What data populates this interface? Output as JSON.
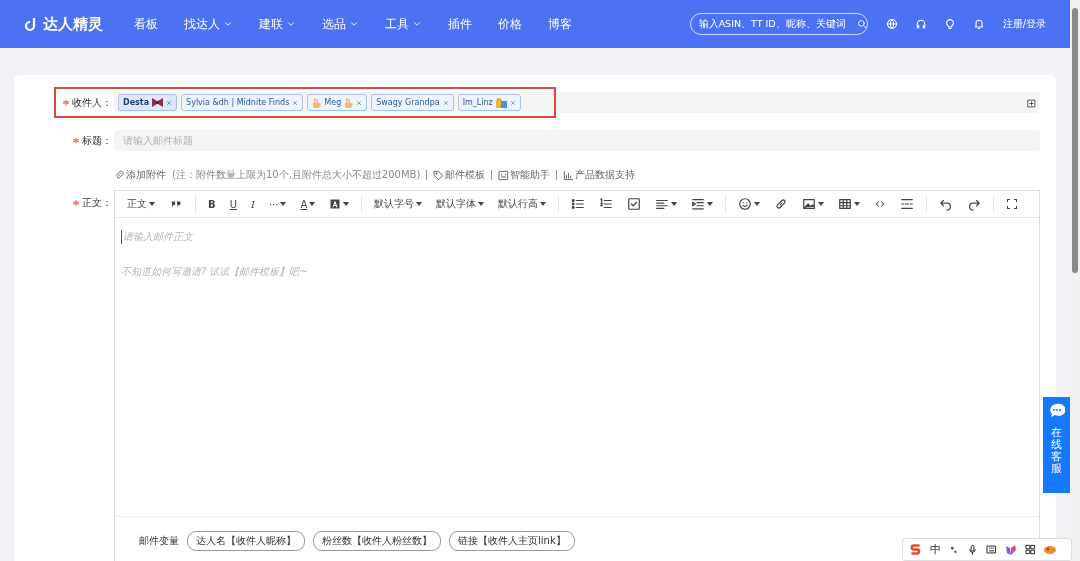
{
  "brand": {
    "name": "达人精灵"
  },
  "nav": [
    {
      "label": "看板",
      "has_menu": false
    },
    {
      "label": "找达人",
      "has_menu": true
    },
    {
      "label": "建联",
      "has_menu": true
    },
    {
      "label": "选品",
      "has_menu": true
    },
    {
      "label": "工具",
      "has_menu": true
    },
    {
      "label": "插件",
      "has_menu": false
    },
    {
      "label": "价格",
      "has_menu": false
    },
    {
      "label": "博客",
      "has_menu": false
    }
  ],
  "search": {
    "placeholder": "输入ASIN、TT ID、昵称、关键词"
  },
  "login": "注册/登录",
  "form": {
    "recipients": {
      "label": "收件人：",
      "required": true,
      "highlighted": true,
      "tags": [
        {
          "label": "Desta",
          "kind": "bow",
          "selected": true
        },
        {
          "label": "Sylvia &dh | Midnite Finds",
          "kind": "plain",
          "selected": false
        },
        {
          "label": "Meg",
          "kind": "hands",
          "selected": false
        },
        {
          "label": "Swagy Grandpa",
          "kind": "plain",
          "selected": false
        },
        {
          "label": "Im_Linz",
          "kind": "bag",
          "selected": false
        }
      ]
    },
    "subject": {
      "label": "标题：",
      "required": true,
      "placeholder": "请输入邮件标题"
    },
    "attachments": [
      {
        "kind": "clip",
        "label": "添加附件"
      },
      {
        "kind": "note",
        "label": "(注：附件数量上限为10个,且附件总大小不超过200MB)"
      },
      {
        "kind": "tag",
        "label": "邮件模板"
      },
      {
        "kind": "robot",
        "label": "智能助手"
      },
      {
        "kind": "chart",
        "label": "产品数据支持"
      }
    ],
    "body": {
      "label": "正文：",
      "required": true,
      "placeholder": "请输入邮件正文",
      "hint": "不知道如何写邀请? 试试【邮件模板】吧~",
      "toolbar": [
        [
          {
            "kind": "text",
            "label": "正文",
            "menu": true
          },
          {
            "kind": "quote"
          }
        ],
        [
          {
            "kind": "bold",
            "label": "B"
          },
          {
            "kind": "underline",
            "label": "U"
          },
          {
            "kind": "italic",
            "label": "I"
          },
          {
            "kind": "text",
            "label": "···",
            "menu": true
          },
          {
            "kind": "fontcolor",
            "label": "A",
            "menu": true
          },
          {
            "kind": "bgcolor",
            "menu": true
          }
        ],
        [
          {
            "kind": "text",
            "label": "默认字号",
            "menu": true
          },
          {
            "kind": "text",
            "label": "默认字体",
            "menu": true
          },
          {
            "kind": "text",
            "label": "默认行高",
            "menu": true
          }
        ],
        [
          {
            "kind": "bullets"
          },
          {
            "kind": "numbers"
          },
          {
            "kind": "todo"
          },
          {
            "kind": "align",
            "menu": true
          },
          {
            "kind": "indent",
            "menu": true
          }
        ],
        [
          {
            "kind": "emoji",
            "menu": true
          },
          {
            "kind": "link"
          },
          {
            "kind": "image",
            "menu": true
          },
          {
            "kind": "table",
            "menu": true
          },
          {
            "kind": "code"
          },
          {
            "kind": "divider"
          }
        ],
        [
          {
            "kind": "undo"
          },
          {
            "kind": "redo"
          }
        ],
        [
          {
            "kind": "fullscreen"
          }
        ]
      ],
      "variables": {
        "label": "邮件变量",
        "chips": [
          "达人名【收件人昵称】",
          "粉丝数【收件人粉丝数】",
          "链接【收件人主页link】"
        ]
      }
    }
  },
  "support": {
    "label": "在线客服"
  },
  "ime": {
    "label": "中"
  }
}
